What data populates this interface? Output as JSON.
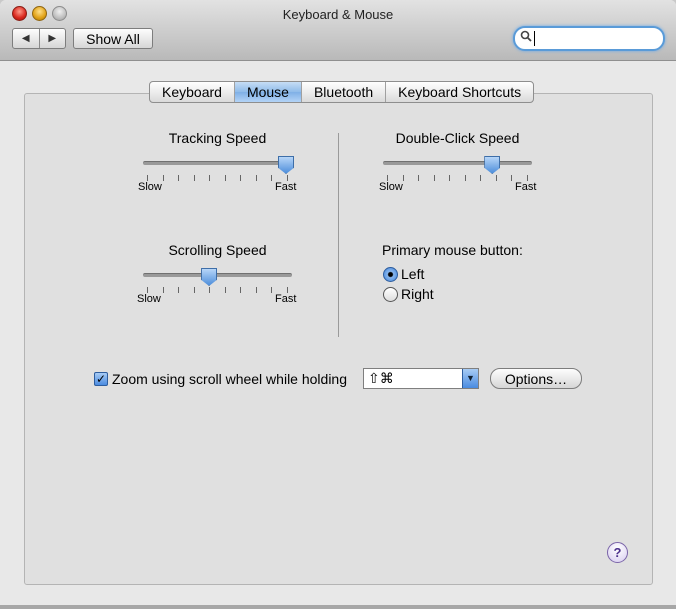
{
  "window": {
    "title": "Keyboard & Mouse"
  },
  "toolbar": {
    "back_icon": "◀",
    "forward_icon": "▶",
    "show_all_label": "Show All",
    "search_icon": "🔍",
    "search_value": ""
  },
  "tabs": [
    {
      "label": "Keyboard",
      "active": false
    },
    {
      "label": "Mouse",
      "active": true
    },
    {
      "label": "Bluetooth",
      "active": false
    },
    {
      "label": "Keyboard Shortcuts",
      "active": false
    }
  ],
  "sliders": {
    "tracking": {
      "label": "Tracking Speed",
      "min_label": "Slow",
      "max_label": "Fast",
      "value": 1.0
    },
    "double_click": {
      "label": "Double-Click Speed",
      "min_label": "Slow",
      "max_label": "Fast",
      "value": 0.75
    },
    "scrolling": {
      "label": "Scrolling Speed",
      "min_label": "Slow",
      "max_label": "Fast",
      "value": 0.43
    }
  },
  "primary_button": {
    "label": "Primary mouse button:",
    "options": [
      "Left",
      "Right"
    ],
    "selected": "Left"
  },
  "zoom": {
    "label": "Zoom using scroll wheel while holding",
    "checked": true,
    "modifier_value": "⇧⌘",
    "options_label": "Options…"
  },
  "help": {
    "label": "?"
  }
}
